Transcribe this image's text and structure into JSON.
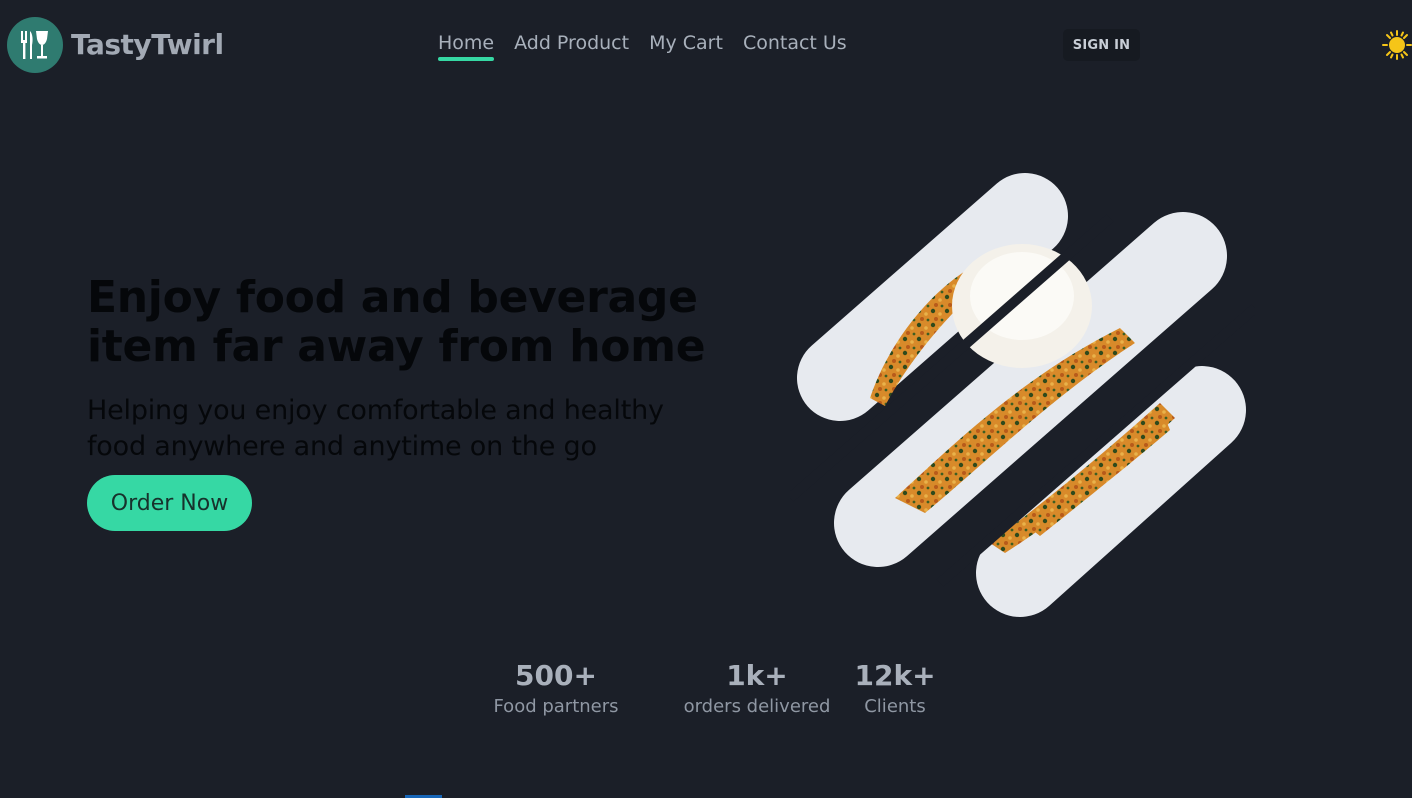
{
  "brand": {
    "name": "TastyTwirl",
    "logo_icon": "cutlery-glass-icon",
    "logo_bg": "#2f7b70"
  },
  "nav": {
    "items": [
      {
        "label": "Home",
        "active": true
      },
      {
        "label": "Add Product",
        "active": false
      },
      {
        "label": "My Cart",
        "active": false
      },
      {
        "label": "Contact Us",
        "active": false
      }
    ],
    "signin_label": "SIGN IN",
    "theme_icon": "sun-icon"
  },
  "hero": {
    "title": "Enjoy food and beverage item far away from home",
    "subtitle": "Helping you enjoy comfortable and healthy food anywhere and anytime on the go",
    "cta_label": "Order Now"
  },
  "stats": [
    {
      "value": "500+",
      "label": "Food partners"
    },
    {
      "value": "1k+",
      "label": "orders delivered"
    },
    {
      "value": "12k+",
      "label": "Clients"
    }
  ],
  "colors": {
    "background": "#1b1f28",
    "accent": "#36d8a4",
    "sun": "#f5c518"
  }
}
